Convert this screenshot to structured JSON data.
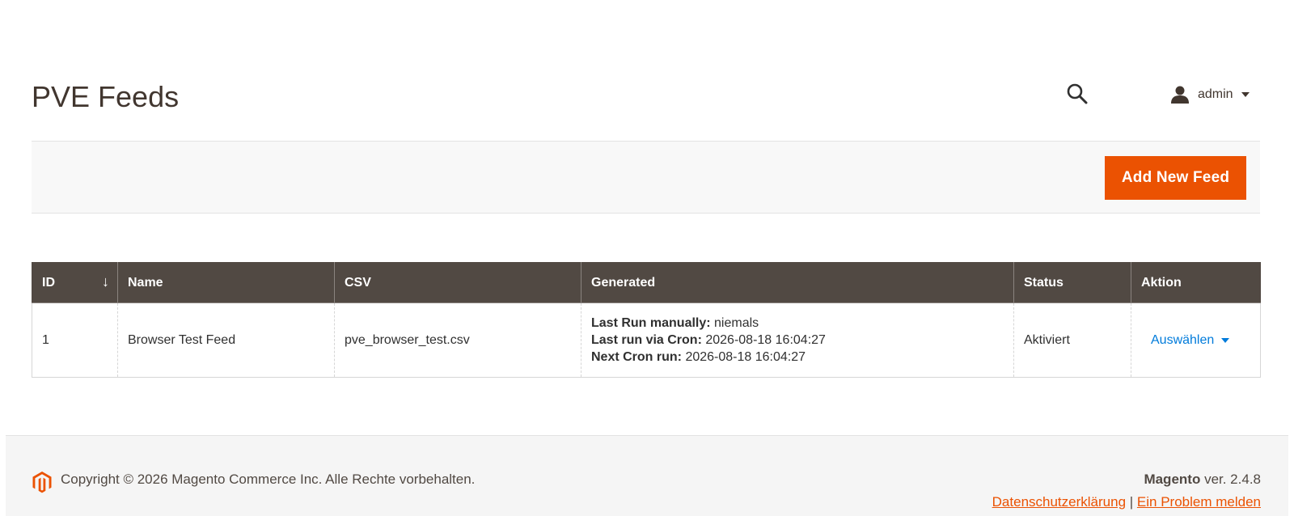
{
  "header": {
    "page_title": "PVE Feeds",
    "user_name": "admin"
  },
  "actions": {
    "add_button_label": "Add New Feed"
  },
  "grid": {
    "columns": {
      "id": "ID",
      "name": "Name",
      "csv": "CSV",
      "generated": "Generated",
      "status": "Status",
      "action": "Aktion"
    },
    "sort_indicator": "↓",
    "rows": [
      {
        "id": "1",
        "name": "Browser Test Feed",
        "csv": "pve_browser_test.csv",
        "generated": {
          "last_run_manually_label": "Last Run manually:",
          "last_run_manually_value": "niemals",
          "last_run_cron_label": "Last run via Cron:",
          "last_run_cron_value": "2026-08-18 16:04:27",
          "next_cron_label": "Next Cron run:",
          "next_cron_value": "2026-08-18 16:04:27"
        },
        "status": "Aktiviert",
        "action_label": "Auswählen"
      }
    ]
  },
  "footer": {
    "copyright": "Copyright © 2026 Magento Commerce Inc. Alle Rechte vorbehalten.",
    "brand": "Magento",
    "version": "ver. 2.4.8",
    "privacy_link": "Datenschutzerklärung",
    "separator": "|",
    "report_link": "Ein Problem melden"
  },
  "colors": {
    "accent": "#eb5202",
    "grid_header": "#514943",
    "link": "#007bdb"
  }
}
